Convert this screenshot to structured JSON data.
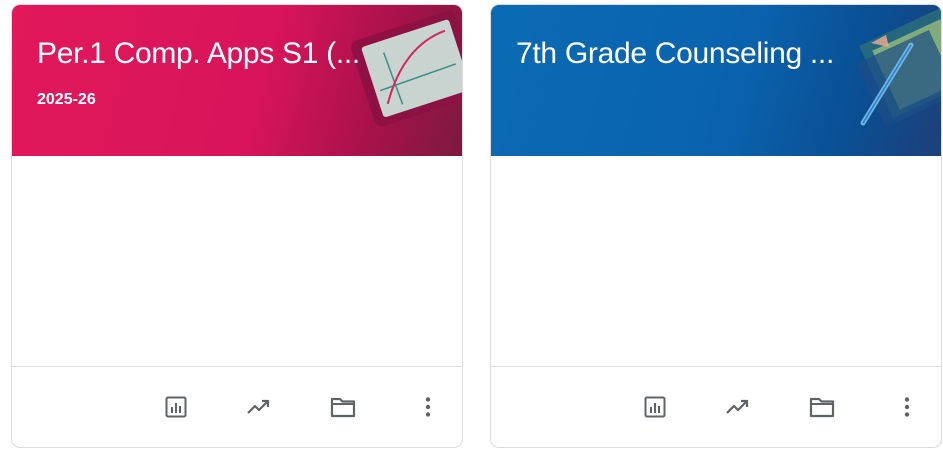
{
  "colors": {
    "card0_banner": "#e1195b",
    "card1_banner": "#0a6bb3",
    "icon": "#5f6368",
    "border": "#dadce0"
  },
  "cards": [
    {
      "title": "Per.1 Comp. Apps S1 (...",
      "subtitle": "2025-26",
      "icons": [
        "gradebook-icon",
        "analytics-icon",
        "folder-icon",
        "more-vert-icon"
      ]
    },
    {
      "title": "7th Grade Counseling ...",
      "subtitle": "",
      "icons": [
        "gradebook-icon",
        "analytics-icon",
        "folder-icon",
        "more-vert-icon"
      ]
    }
  ]
}
